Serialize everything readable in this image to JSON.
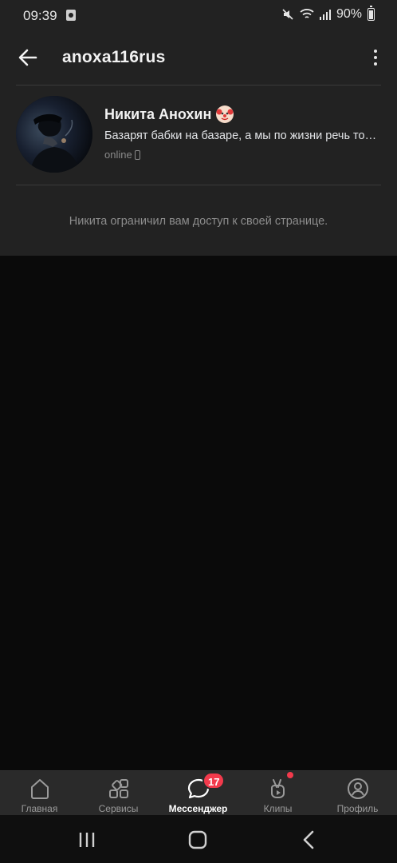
{
  "status_bar": {
    "time": "09:39",
    "battery": "90%"
  },
  "header": {
    "title": "anoxa116rus"
  },
  "profile": {
    "name": "Никита Анохин",
    "status": "Базарят бабки на базаре, а мы по жизни речь то…",
    "online": "online",
    "restricted_message": "Никита ограничил вам доступ к своей странице."
  },
  "bottom_nav": {
    "items": [
      {
        "label": "Главная",
        "icon": "home-icon"
      },
      {
        "label": "Сервисы",
        "icon": "services-grid-icon"
      },
      {
        "label": "Мессенджер",
        "icon": "chat-bubble-icon",
        "badge": "17",
        "active": true
      },
      {
        "label": "Клипы",
        "icon": "clips-icon",
        "dot": true
      },
      {
        "label": "Профиль",
        "icon": "profile-icon"
      }
    ]
  },
  "colors": {
    "background": "#0a0a0a",
    "panel": "#222222",
    "badge": "#f23a4c",
    "muted_text": "#8d8d8d"
  }
}
